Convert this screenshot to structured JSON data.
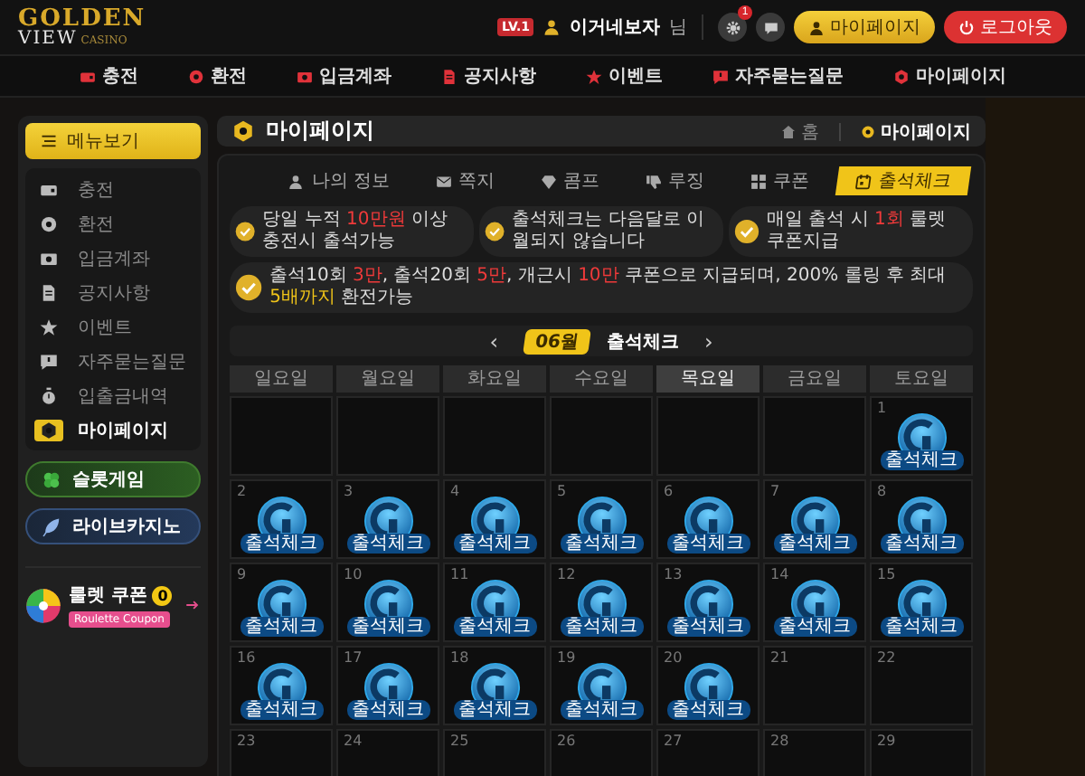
{
  "header": {
    "logo": [
      "GOLDEN",
      "VIEW",
      "CASINO"
    ],
    "level": "LV.1",
    "username": "이거네보자",
    "honorific": "님",
    "settings_badge": "1",
    "buttons": [
      {
        "kind": "mypage",
        "label": "마이페이지"
      },
      {
        "kind": "logout",
        "label": "로그아웃"
      }
    ]
  },
  "nav": [
    {
      "label": "충전"
    },
    {
      "label": "환전"
    },
    {
      "label": "입금계좌"
    },
    {
      "label": "공지사항"
    },
    {
      "label": "이벤트"
    },
    {
      "label": "자주묻는질문"
    },
    {
      "label": "마이페이지"
    }
  ],
  "sidebar": {
    "menu_button": "메뉴보기",
    "items": [
      {
        "label": "충전",
        "selected": false
      },
      {
        "label": "환전",
        "selected": false
      },
      {
        "label": "입금계좌",
        "selected": false
      },
      {
        "label": "공지사항",
        "selected": false
      },
      {
        "label": "이벤트",
        "selected": false
      },
      {
        "label": "자주묻는질문",
        "selected": false
      },
      {
        "label": "입출금내역",
        "selected": false
      },
      {
        "label": "마이페이지",
        "selected": true
      }
    ],
    "games": [
      {
        "kind": "slot",
        "label": "슬롯게임"
      },
      {
        "kind": "live",
        "label": "라이브카지노"
      }
    ],
    "roulette": {
      "title": "룰렛 쿠폰",
      "count": "0",
      "tag": "Roulette Coupon"
    }
  },
  "page_header": {
    "title": "마이페이지",
    "breadcrumb": [
      "홈",
      "마이페이지"
    ]
  },
  "tabs": [
    {
      "label": "나의 정보",
      "selected": false
    },
    {
      "label": "쪽지",
      "selected": false
    },
    {
      "label": "콤프",
      "selected": false
    },
    {
      "label": "루징",
      "selected": false
    },
    {
      "label": "쿠폰",
      "selected": false
    },
    {
      "label": "출석체크",
      "selected": true
    }
  ],
  "notices": [
    {
      "parts": [
        {
          "kind": "plain",
          "text": "당일 누적 "
        },
        {
          "kind": "highlight",
          "text": "10만원"
        },
        {
          "kind": "plain",
          "text": " 이상 충전시 출석가능"
        }
      ]
    },
    {
      "parts": [
        {
          "kind": "plain",
          "text": "출석체크는 다음달로 이월되지 않습니다"
        }
      ]
    },
    {
      "parts": [
        {
          "kind": "plain",
          "text": "매일 출석 시 "
        },
        {
          "kind": "highlight",
          "text": "1회"
        },
        {
          "kind": "plain",
          "text": " 룰렛쿠폰지급"
        }
      ]
    },
    {
      "parts": [
        {
          "kind": "plain",
          "text": "출석10회 "
        },
        {
          "kind": "highlight",
          "text": "3만"
        },
        {
          "kind": "plain",
          "text": ", 출석20회 "
        },
        {
          "kind": "highlight",
          "text": "5만"
        },
        {
          "kind": "plain",
          "text": ", 개근시 "
        },
        {
          "kind": "highlight",
          "text": "10만"
        },
        {
          "kind": "plain",
          "text": " 쿠폰으로 지급되며, 200% 롤링 후 최대 "
        },
        {
          "kind": "accent",
          "text": "5배까지"
        },
        {
          "kind": "plain",
          "text": " 환전가능"
        }
      ]
    }
  ],
  "calendar": {
    "prev": "‹",
    "month": "06월",
    "title": "출석체크",
    "next": "›",
    "weekdays": [
      {
        "label": "일요일",
        "selected": false
      },
      {
        "label": "월요일",
        "selected": false
      },
      {
        "label": "화요일",
        "selected": false
      },
      {
        "label": "수요일",
        "selected": false
      },
      {
        "label": "목요일",
        "selected": true
      },
      {
        "label": "금요일",
        "selected": false
      },
      {
        "label": "토요일",
        "selected": false
      }
    ],
    "cells": [
      {
        "kind": "blank"
      },
      {
        "kind": "blank"
      },
      {
        "kind": "blank"
      },
      {
        "kind": "blank"
      },
      {
        "kind": "blank"
      },
      {
        "kind": "blank"
      },
      {
        "kind": "day",
        "day": "1",
        "checked": true,
        "stamp": "출석체크"
      },
      {
        "kind": "day",
        "day": "2",
        "checked": true,
        "stamp": "출석체크"
      },
      {
        "kind": "day",
        "day": "3",
        "checked": true,
        "stamp": "출석체크"
      },
      {
        "kind": "day",
        "day": "4",
        "checked": true,
        "stamp": "출석체크"
      },
      {
        "kind": "day",
        "day": "5",
        "checked": true,
        "stamp": "출석체크"
      },
      {
        "kind": "day",
        "day": "6",
        "checked": true,
        "stamp": "출석체크"
      },
      {
        "kind": "day",
        "day": "7",
        "checked": true,
        "stamp": "출석체크"
      },
      {
        "kind": "day",
        "day": "8",
        "checked": true,
        "stamp": "출석체크"
      },
      {
        "kind": "day",
        "day": "9",
        "checked": true,
        "stamp": "출석체크"
      },
      {
        "kind": "day",
        "day": "10",
        "checked": true,
        "stamp": "출석체크"
      },
      {
        "kind": "day",
        "day": "11",
        "checked": true,
        "stamp": "출석체크"
      },
      {
        "kind": "day",
        "day": "12",
        "checked": true,
        "stamp": "출석체크"
      },
      {
        "kind": "day",
        "day": "13",
        "checked": true,
        "stamp": "출석체크"
      },
      {
        "kind": "day",
        "day": "14",
        "checked": true,
        "stamp": "출석체크"
      },
      {
        "kind": "day",
        "day": "15",
        "checked": true,
        "stamp": "출석체크"
      },
      {
        "kind": "day",
        "day": "16",
        "checked": true,
        "stamp": "출석체크"
      },
      {
        "kind": "day",
        "day": "17",
        "checked": true,
        "stamp": "출석체크"
      },
      {
        "kind": "day",
        "day": "18",
        "checked": true,
        "stamp": "출석체크"
      },
      {
        "kind": "day",
        "day": "19",
        "checked": true,
        "stamp": "출석체크"
      },
      {
        "kind": "day",
        "day": "20",
        "checked": true,
        "stamp": "출석체크"
      },
      {
        "kind": "day",
        "day": "21",
        "checked": false
      },
      {
        "kind": "day",
        "day": "22",
        "checked": false
      },
      {
        "kind": "day",
        "day": "23",
        "checked": false
      },
      {
        "kind": "day",
        "day": "24",
        "checked": false
      },
      {
        "kind": "day",
        "day": "25",
        "checked": false
      },
      {
        "kind": "day",
        "day": "26",
        "checked": false
      },
      {
        "kind": "day",
        "day": "27",
        "checked": false
      },
      {
        "kind": "day",
        "day": "28",
        "checked": false
      },
      {
        "kind": "day",
        "day": "29",
        "checked": false
      }
    ]
  }
}
